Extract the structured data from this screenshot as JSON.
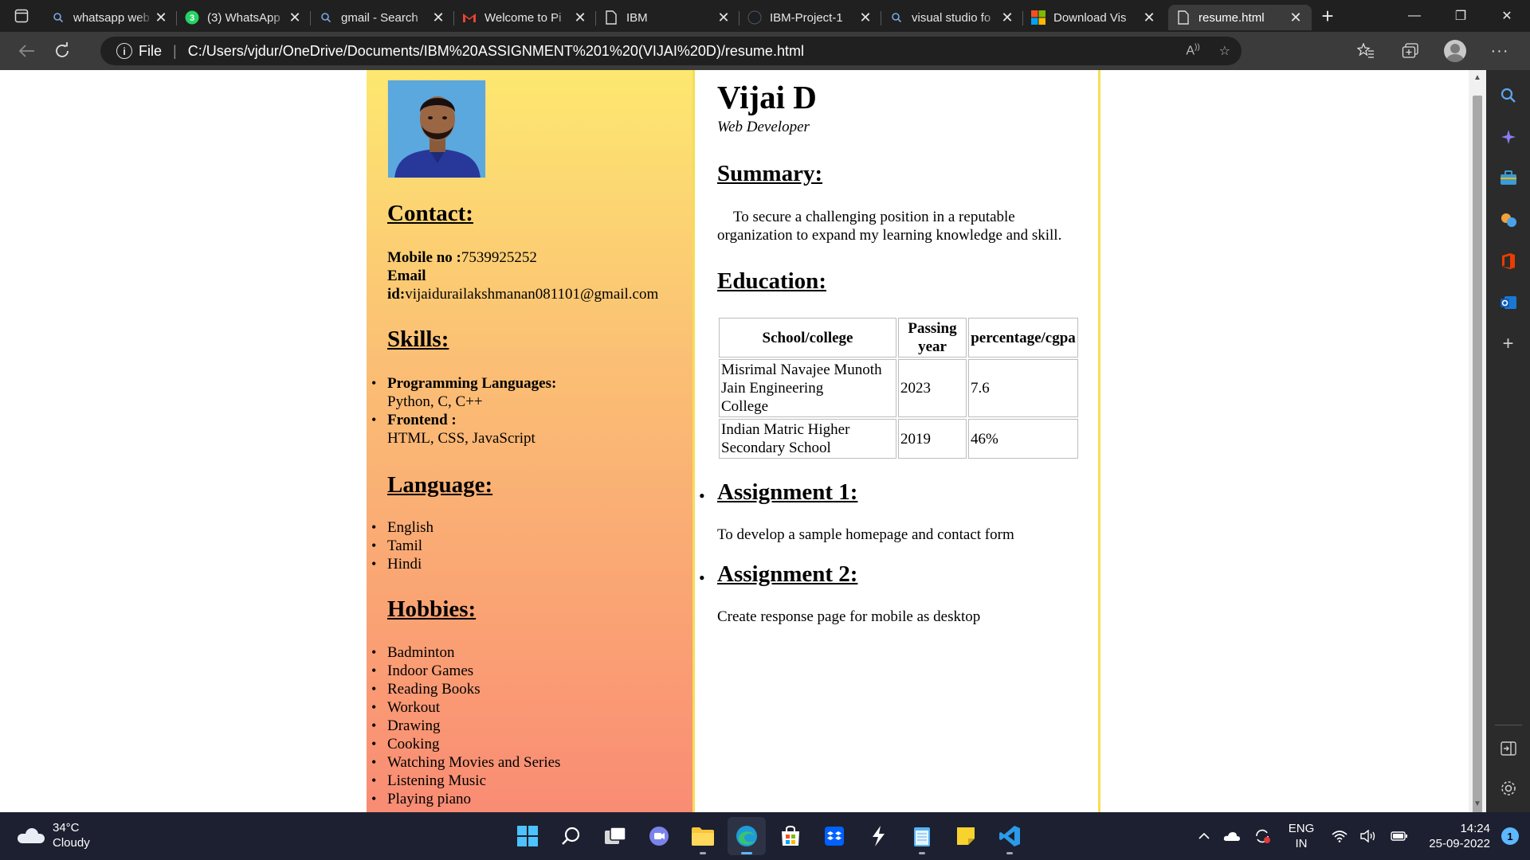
{
  "browser": {
    "tabs": [
      {
        "title": "whatsapp web",
        "icon": "search-icon"
      },
      {
        "title": "(3) WhatsApp",
        "icon": "whatsapp-icon",
        "badge": "3"
      },
      {
        "title": "gmail - Search",
        "icon": "search-icon"
      },
      {
        "title": "Welcome to Pi",
        "icon": "gmail-icon"
      },
      {
        "title": "IBM",
        "icon": "page-icon"
      },
      {
        "title": "IBM-Project-1",
        "icon": "github-icon"
      },
      {
        "title": "visual studio fo",
        "icon": "search-icon"
      },
      {
        "title": "Download Vis",
        "icon": "microsoft-icon"
      },
      {
        "title": "resume.html",
        "icon": "page-icon",
        "active": true
      }
    ],
    "address": {
      "scheme_label": "File",
      "url": "C:/Users/vjdur/OneDrive/Documents/IBM%20ASSIGNMENT%201%20(VIJAI%20D)/resume.html"
    }
  },
  "resume": {
    "name": "Vijai D",
    "role": "Web Developer",
    "contact": {
      "heading": "Contact:",
      "mobile_label": "Mobile no :",
      "mobile": "7539925252",
      "email_label_1": "Email",
      "email_label_2": "id:",
      "email": "vijaidurailakshmanan081101@gmail.com"
    },
    "skills": {
      "heading": "Skills:",
      "items": [
        {
          "label": "Programming Languages:",
          "value": "Python, C, C++"
        },
        {
          "label": "Frontend :",
          "value": "HTML, CSS, JavaScript"
        }
      ]
    },
    "language": {
      "heading": "Language:",
      "items": [
        "English",
        "Tamil",
        "Hindi"
      ]
    },
    "hobbies": {
      "heading": "Hobbies:",
      "items": [
        "Badminton",
        "Indoor Games",
        "Reading Books",
        "Workout",
        "Drawing",
        "Cooking",
        "Watching Movies and Series",
        "Listening Music",
        "Playing piano"
      ]
    },
    "summary": {
      "heading": "Summary:",
      "line1": "To secure a challenging position in a reputable",
      "line2": "organization to expand my learning knowledge and skill."
    },
    "education": {
      "heading": "Education:",
      "headers": [
        "School/college",
        "Passing",
        "year",
        "percentage/cgpa"
      ],
      "rows": [
        {
          "school_1": "Misrimal Navajee Munoth",
          "school_2": "Jain Engineering",
          "school_3": "College",
          "year": "2023",
          "score": "7.6"
        },
        {
          "school_1": "Indian Matric Higher",
          "school_2": "Secondary School",
          "year": "2019",
          "score": "46%"
        }
      ]
    },
    "assignments": [
      {
        "heading": "Assignment 1:",
        "text": "To develop a sample homepage and contact form"
      },
      {
        "heading": "Assignment 2:",
        "text": "Create response page for mobile as desktop"
      }
    ]
  },
  "taskbar": {
    "weather": {
      "temp": "34°C",
      "condition": "Cloudy"
    },
    "lang_1": "ENG",
    "lang_2": "IN",
    "time": "14:24",
    "date": "25-09-2022",
    "notifications": "1"
  }
}
